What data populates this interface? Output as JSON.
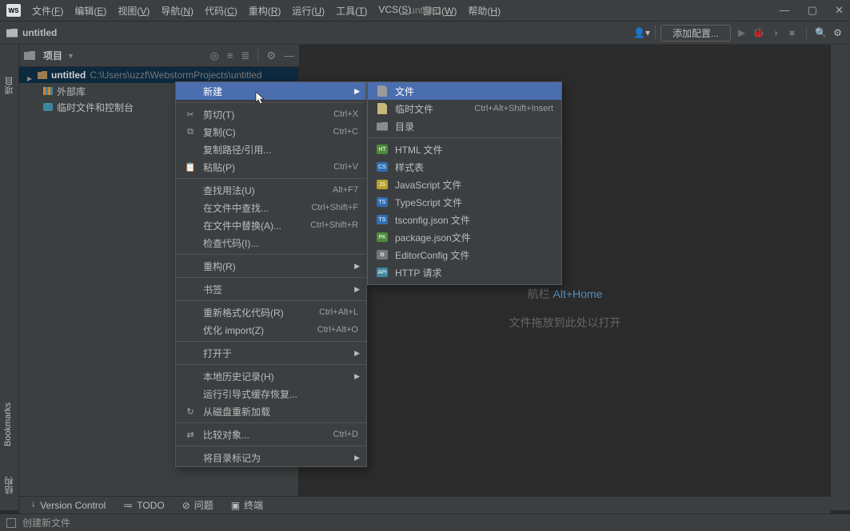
{
  "window_title": "untitled",
  "menus": [
    "文件(F)",
    "编辑(E)",
    "视图(V)",
    "导航(N)",
    "代码(C)",
    "重构(R)",
    "运行(U)",
    "工具(T)",
    "VCS(S)",
    "窗口(W)",
    "帮助(H)"
  ],
  "breadcrumb": "untitled",
  "add_config": "添加配置...",
  "project_label": "项目",
  "left_rail": {
    "top": "项目",
    "mid": "Bookmarks",
    "bot": "结构"
  },
  "tree": {
    "root_name": "untitled",
    "root_path": "C:\\Users\\uzzf\\WebstormProjects\\untitled",
    "ext_lib": "外部库",
    "scratch": "临时文件和控制台"
  },
  "editor_hint_nav_pre": "航栏  ",
  "editor_hint_nav_key": "Alt+Home",
  "editor_hint_drop": "文件拖放到此处以打开",
  "tool_windows": [
    "Version Control",
    "TODO",
    "问题",
    "终端"
  ],
  "status": "创建新文件",
  "context_menu": [
    {
      "icon": "",
      "label": "新建",
      "shortcut": "",
      "arrow": true,
      "hl": true
    },
    {
      "sep": true
    },
    {
      "icon": "✂",
      "label": "剪切(T)",
      "shortcut": "Ctrl+X"
    },
    {
      "icon": "⧉",
      "label": "复制(C)",
      "shortcut": "Ctrl+C"
    },
    {
      "icon": "",
      "label": "复制路径/引用...",
      "shortcut": ""
    },
    {
      "icon": "📋",
      "label": "粘贴(P)",
      "shortcut": "Ctrl+V"
    },
    {
      "sep": true
    },
    {
      "icon": "",
      "label": "查找用法(U)",
      "shortcut": "Alt+F7"
    },
    {
      "icon": "",
      "label": "在文件中查找...",
      "shortcut": "Ctrl+Shift+F"
    },
    {
      "icon": "",
      "label": "在文件中替换(A)...",
      "shortcut": "Ctrl+Shift+R"
    },
    {
      "icon": "",
      "label": "检查代码(I)...",
      "shortcut": ""
    },
    {
      "sep": true
    },
    {
      "icon": "",
      "label": "重构(R)",
      "shortcut": "",
      "arrow": true
    },
    {
      "sep": true
    },
    {
      "icon": "",
      "label": "书签",
      "shortcut": "",
      "arrow": true
    },
    {
      "sep": true
    },
    {
      "icon": "",
      "label": "重新格式化代码(R)",
      "shortcut": "Ctrl+Alt+L"
    },
    {
      "icon": "",
      "label": "优化 import(Z)",
      "shortcut": "Ctrl+Alt+O"
    },
    {
      "sep": true
    },
    {
      "icon": "",
      "label": "打开于",
      "shortcut": "",
      "arrow": true
    },
    {
      "sep": true
    },
    {
      "icon": "",
      "label": "本地历史记录(H)",
      "shortcut": "",
      "arrow": true
    },
    {
      "icon": "",
      "label": "运行引导式缓存恢复...",
      "shortcut": ""
    },
    {
      "icon": "↻",
      "label": "从磁盘重新加载",
      "shortcut": ""
    },
    {
      "sep": true
    },
    {
      "icon": "⇄",
      "label": "比较对象...",
      "shortcut": "Ctrl+D"
    },
    {
      "sep": true
    },
    {
      "icon": "",
      "label": "将目录标记为",
      "shortcut": "",
      "arrow": true
    }
  ],
  "new_menu": [
    {
      "type": "file",
      "label": "文件",
      "hl": true
    },
    {
      "type": "scratch",
      "label": "临时文件",
      "shortcut": "Ctrl+Alt+Shift+Insert"
    },
    {
      "type": "folder",
      "label": "目录"
    },
    {
      "sep": true
    },
    {
      "type": "html",
      "label": "HTML 文件",
      "bg": "#4b8c3b"
    },
    {
      "type": "css",
      "label": "样式表",
      "bg": "#2f6fb3"
    },
    {
      "type": "js",
      "label": "JavaScript 文件",
      "bg": "#b8a12f"
    },
    {
      "type": "ts",
      "label": "TypeScript 文件",
      "bg": "#2f6fb3"
    },
    {
      "type": "tsc",
      "label": "tsconfig.json 文件",
      "bg": "#2f6fb3"
    },
    {
      "type": "pkg",
      "label": "package.json文件",
      "bg": "#4b8c3b"
    },
    {
      "type": "cfg",
      "label": "EditorConfig 文件",
      "bg": "#777"
    },
    {
      "type": "api",
      "label": "HTTP 请求",
      "bg": "#3e86a0",
      "last": true
    }
  ]
}
